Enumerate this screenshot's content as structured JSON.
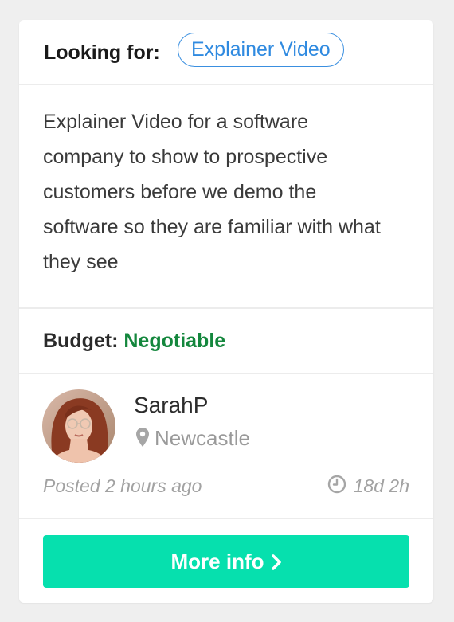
{
  "request": {
    "looking_for_label": "Looking for:",
    "category_tag": "Explainer Video",
    "description": "Explainer Video for a software company to show to prospective customers before we demo the software so they are familiar with what they see",
    "budget_label": "Budget:",
    "budget_value": "Negotiable"
  },
  "poster": {
    "username": "SarahP",
    "location": "Newcastle",
    "location_icon": "map-pin-icon",
    "posted": "Posted 2 hours ago",
    "time_left": "18d 2h",
    "time_icon": "clock-icon"
  },
  "actions": {
    "more_info_label": "More info",
    "more_info_icon": "chevron-right-icon"
  },
  "colors": {
    "tag_blue": "#2f8ae0",
    "budget_green": "#14873d",
    "button_teal": "#06e0ae",
    "muted_gray": "#a2a2a2"
  }
}
